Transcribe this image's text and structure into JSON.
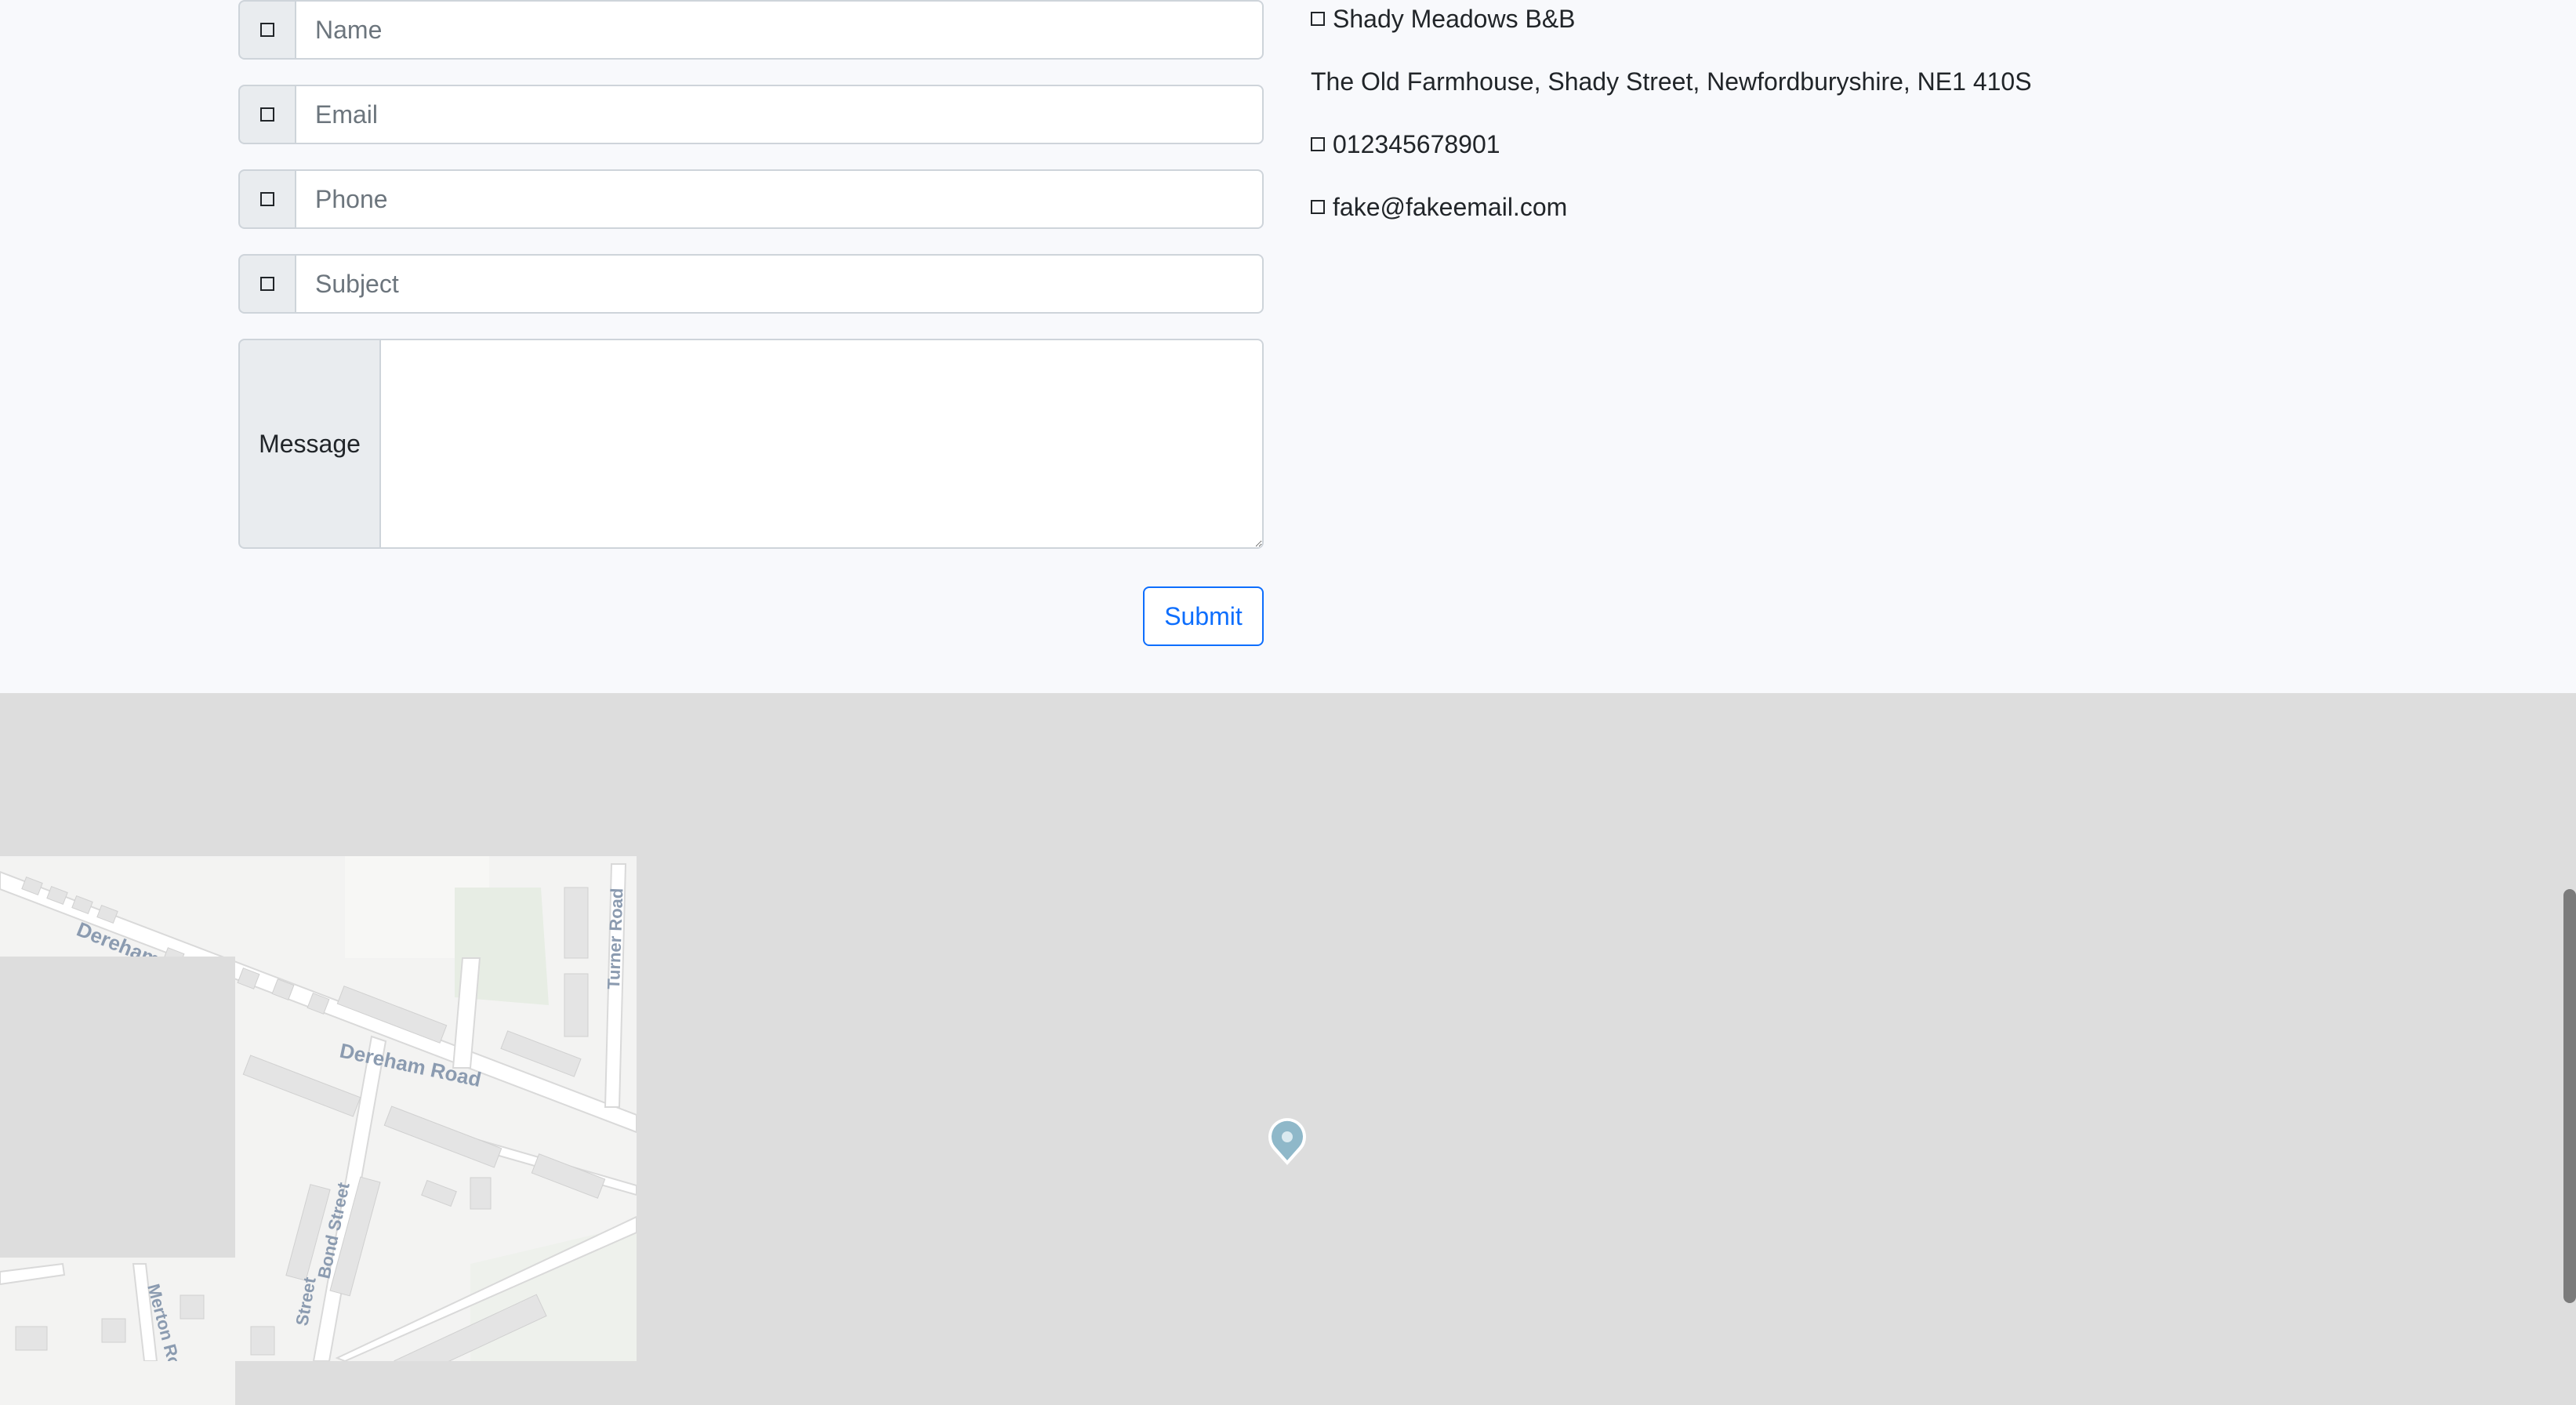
{
  "form": {
    "name_placeholder": "Name",
    "email_placeholder": "Email",
    "phone_placeholder": "Phone",
    "subject_placeholder": "Subject",
    "message_label": "Message",
    "message_value": "",
    "submit_label": "Submit"
  },
  "contact": {
    "business_name": "Shady Meadows B&B",
    "address": "The Old Farmhouse, Shady Street, Newfordburyshire, NE1 410S",
    "phone": "012345678901",
    "email": "fake@fakeemail.com"
  },
  "map": {
    "street_labels": {
      "dereham_road": "Dereham Road",
      "dereham_road_partial": "Dereham",
      "turner_road": "Turner Road",
      "bond_street": "Bond Street",
      "street": "Street",
      "merton_road": "Merton Road"
    }
  },
  "icons": {
    "field_icon": "square-icon",
    "map_pin": "map-pin-icon"
  },
  "colors": {
    "accent": "#0d6efd",
    "page_background": "#f8f9fc",
    "map_background": "#dddddd",
    "addon_background": "#e9ecef",
    "pin": "#8fb8c9"
  }
}
